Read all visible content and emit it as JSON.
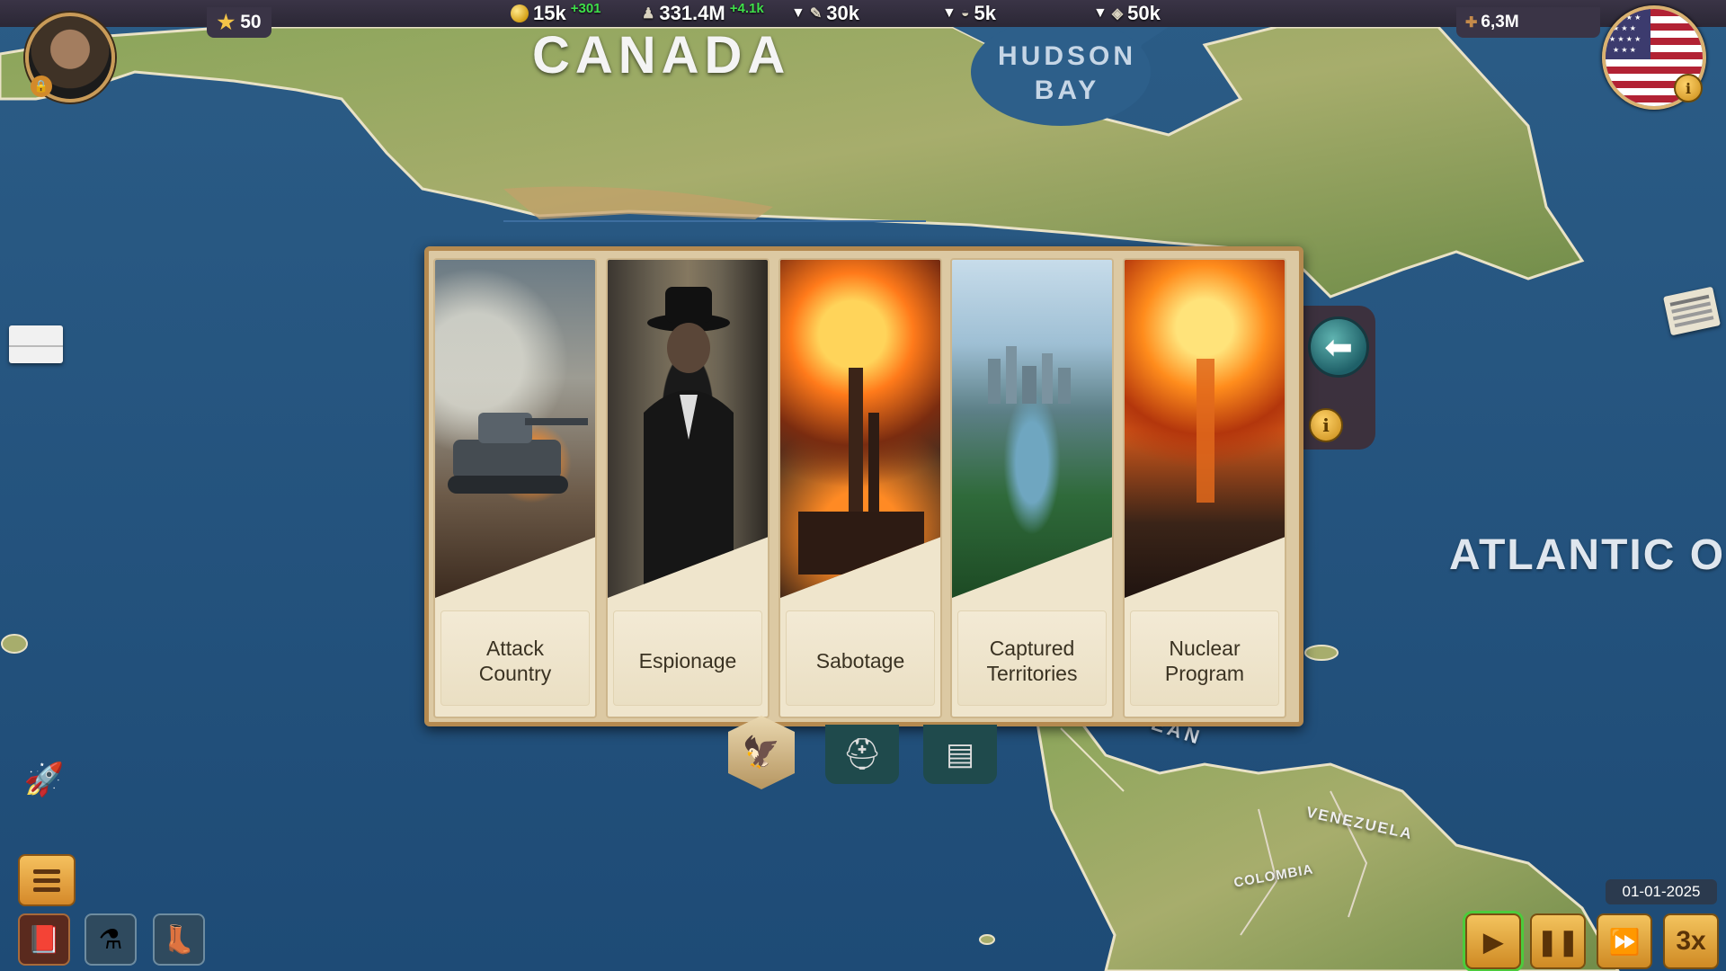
{
  "topbar": {
    "coins": "15k",
    "coins_delta": "+301",
    "population": "331.4M",
    "population_delta": "+4.1k",
    "res_a": "30k",
    "res_b": "5k",
    "res_c": "50k",
    "stars": "50",
    "army": "6,3M"
  },
  "map": {
    "canada": "CANADA",
    "hudson_1": "HUDSON",
    "hudson_2": "BAY",
    "atlantic": "ATLANTIC O",
    "venezuela": "VENEZUELA",
    "colombia": "COLOMBIA",
    "caribbean": "EAN"
  },
  "cards": [
    {
      "label_1": "Attack",
      "label_2": "Country"
    },
    {
      "label_1": "Espionage",
      "label_2": ""
    },
    {
      "label_1": "Sabotage",
      "label_2": ""
    },
    {
      "label_1": "Captured",
      "label_2": "Territories"
    },
    {
      "label_1": "Nuclear",
      "label_2": "Program"
    }
  ],
  "controls": {
    "date": "01-01-2025",
    "speed": "3x"
  },
  "icons": {
    "star": "star-icon",
    "coin": "coin-icon",
    "population": "population-icon",
    "back": "arrow-left-icon",
    "info": "info-icon"
  }
}
